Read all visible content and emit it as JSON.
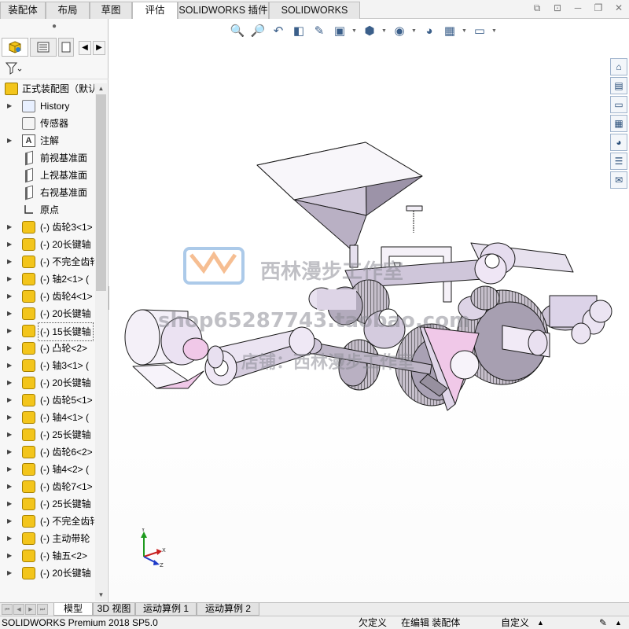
{
  "top_tabs": [
    "装配体",
    "布局",
    "草图",
    "评估",
    "SOLIDWORKS 插件",
    "SOLIDWORKS MBD"
  ],
  "active_top_tab": "评估",
  "window_controls": [
    "restore-tile-icon",
    "tile-icon",
    "minimize-icon",
    "maximize-icon",
    "close-icon"
  ],
  "panel_tabs": [
    "feature-manager-icon",
    "property-manager-icon",
    "configuration-manager-icon"
  ],
  "tree": {
    "root": "正式装配图（默认",
    "items": [
      {
        "label": "History",
        "icon": "history-icon",
        "expand": true
      },
      {
        "label": "传感器",
        "icon": "sensor-icon",
        "expand": false
      },
      {
        "label": "注解",
        "icon": "annotation-icon",
        "expand": true
      },
      {
        "label": "前视基准面",
        "icon": "plane-icon",
        "expand": false
      },
      {
        "label": "上视基准面",
        "icon": "plane-icon",
        "expand": false
      },
      {
        "label": "右视基准面",
        "icon": "plane-icon",
        "expand": false
      },
      {
        "label": "原点",
        "icon": "origin-icon",
        "expand": false
      },
      {
        "label": "(-) 齿轮3<1>",
        "icon": "part-icon",
        "expand": true
      },
      {
        "label": "(-) 20长键轴",
        "icon": "part-icon",
        "expand": true
      },
      {
        "label": "(-) 不完全齿轮",
        "icon": "part-icon",
        "expand": true
      },
      {
        "label": "(-) 轴2<1> (",
        "icon": "part-icon",
        "expand": true
      },
      {
        "label": "(-) 齿轮4<1>",
        "icon": "part-icon",
        "expand": true
      },
      {
        "label": "(-) 20长键轴",
        "icon": "part-icon",
        "expand": true
      },
      {
        "label": "(-) 15长键轴",
        "icon": "part-icon",
        "expand": true,
        "selected": true
      },
      {
        "label": "(-) 凸轮<2>",
        "icon": "part-icon",
        "expand": true
      },
      {
        "label": "(-) 轴3<1> (",
        "icon": "part-icon",
        "expand": true
      },
      {
        "label": "(-) 20长键轴",
        "icon": "part-icon",
        "expand": true
      },
      {
        "label": "(-) 齿轮5<1>",
        "icon": "part-icon",
        "expand": true
      },
      {
        "label": "(-) 轴4<1> (",
        "icon": "part-icon",
        "expand": true
      },
      {
        "label": "(-) 25长键轴",
        "icon": "part-icon",
        "expand": true
      },
      {
        "label": "(-) 齿轮6<2>",
        "icon": "part-icon",
        "expand": true
      },
      {
        "label": "(-) 轴4<2> (",
        "icon": "part-icon",
        "expand": true
      },
      {
        "label": "(-) 齿轮7<1>",
        "icon": "part-icon",
        "expand": true
      },
      {
        "label": "(-) 25长键轴",
        "icon": "part-icon",
        "expand": true
      },
      {
        "label": "(-) 不完全齿轮",
        "icon": "part-icon",
        "expand": true
      },
      {
        "label": "(-) 主动带轮",
        "icon": "part-icon",
        "expand": true
      },
      {
        "label": "(-) 轴五<2>",
        "icon": "part-icon",
        "expand": true
      },
      {
        "label": "(-) 20长键轴",
        "icon": "part-icon",
        "expand": true
      }
    ]
  },
  "view_toolbar": [
    "zoom-to-fit-icon",
    "zoom-to-area-icon",
    "previous-view-icon",
    "section-view-icon",
    "dynamic-annotation-icon",
    "view-orientation-icon",
    "display-style-icon",
    "hide-show-icon",
    "edit-appearance-icon",
    "apply-scene-icon",
    "view-settings-icon"
  ],
  "task_pane": [
    "home-icon",
    "design-library-icon",
    "file-explorer-icon",
    "view-palette-icon",
    "appearances-icon",
    "custom-properties-icon",
    "forum-icon"
  ],
  "watermark": {
    "line1": "西林漫步工作室",
    "line2": "shop65287743.taobao.com",
    "line3": "店铺：西林漫步工作室"
  },
  "triad": {
    "x": "X",
    "y": "Y",
    "z": "Z"
  },
  "bottom_tabs": [
    "模型",
    "3D 视图",
    "运动算例 1",
    "运动算例 2"
  ],
  "active_bottom_tab": "模型",
  "status": {
    "product": "SOLIDWORKS Premium 2018 SP5.0",
    "define_state": "欠定义",
    "editing": "在编辑 装配体",
    "units": "自定义"
  },
  "colors": {
    "part_fill": "#dcd3e8",
    "part_accent": "#f0c8e8",
    "gear_fill": "#b7b0bc",
    "edge": "#1a1a1a",
    "tree_icon": "#f3c51b"
  }
}
